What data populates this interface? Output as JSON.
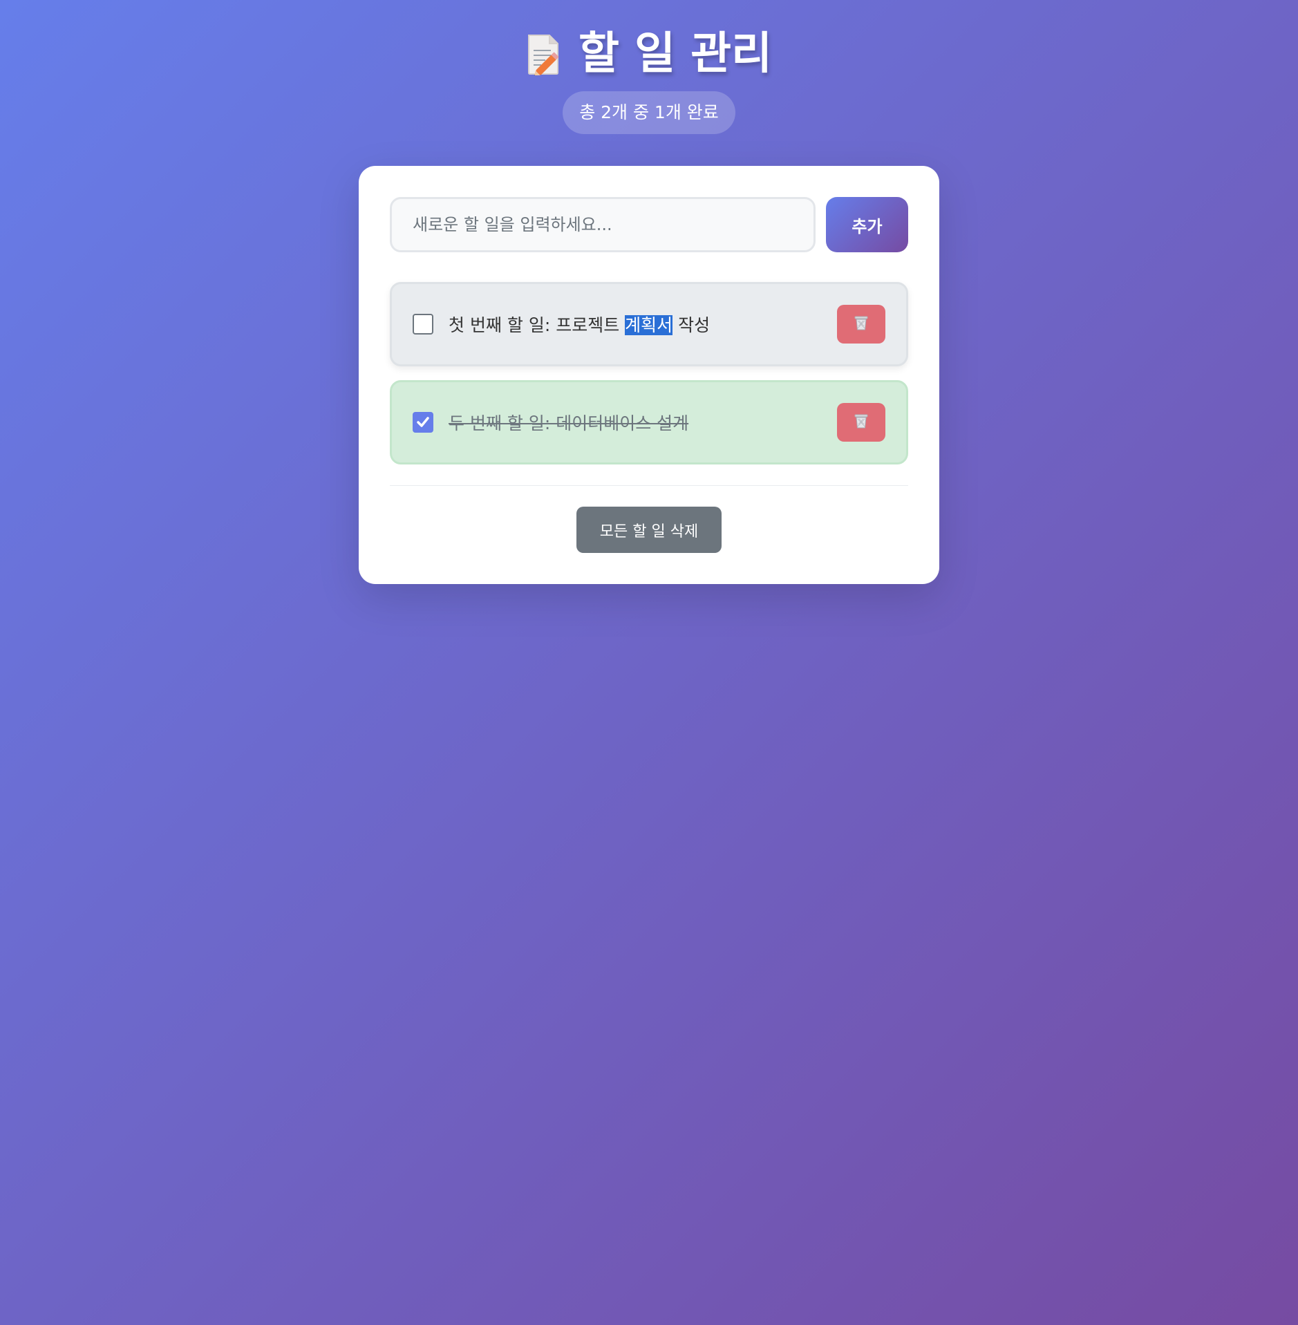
{
  "header": {
    "title": "할 일 관리",
    "title_icon": "memo-icon",
    "stats": "총 2개 중 1개 완료"
  },
  "input": {
    "placeholder": "새로운 할 일을 입력하세요...",
    "value": "",
    "add_label": "추가"
  },
  "todos": [
    {
      "text_before": "첫 번째 할 일: 프로젝트 ",
      "text_selected": "계획서",
      "text_after": " 작성",
      "completed": false,
      "delete_icon": "trash-icon"
    },
    {
      "text": "두 번째 할 일: 데이터베이스 설계",
      "completed": true,
      "delete_icon": "trash-icon"
    }
  ],
  "footer": {
    "clear_label": "모든 할 일 삭제"
  },
  "colors": {
    "gradient_start": "#667eea",
    "gradient_end": "#764ba2",
    "delete": "#e06c75",
    "completed_bg": "#d4edda",
    "clear_button": "#6c757d"
  }
}
